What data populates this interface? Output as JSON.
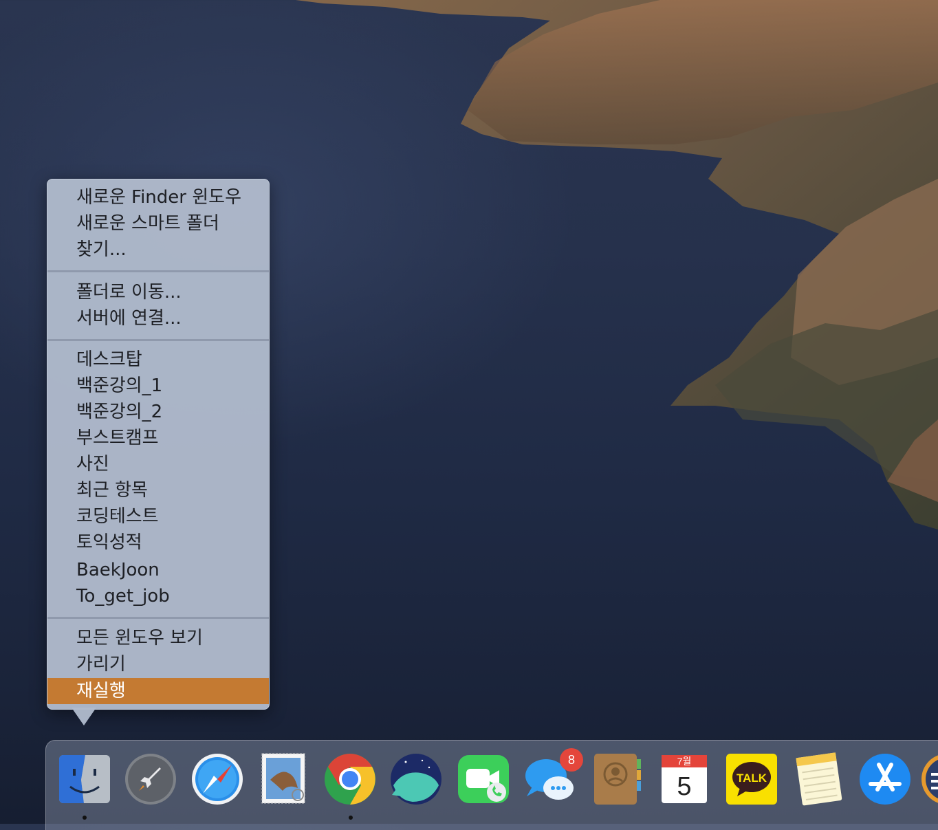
{
  "context_menu": {
    "app": "Finder",
    "groups": [
      [
        "새로운 Finder 윈도우",
        "새로운 스마트 폴더",
        "찾기..."
      ],
      [
        "폴더로 이동...",
        "서버에 연결..."
      ],
      [
        "데스크탑",
        "백준강의_1",
        "백준강의_2",
        "부스트캠프",
        "사진",
        "최근 항목",
        "코딩테스트",
        "토익성적",
        "BaekJoon",
        "To_get_job"
      ],
      [
        "모든 윈도우 보기",
        "가리기",
        "재실행"
      ]
    ],
    "highlighted_item": "재실행",
    "highlight_color": "#c47a32"
  },
  "dock": {
    "apps": [
      {
        "name": "Finder",
        "icon": "finder-icon",
        "running": true
      },
      {
        "name": "Launchpad",
        "icon": "launchpad-icon",
        "running": false
      },
      {
        "name": "Safari",
        "icon": "safari-icon",
        "running": false
      },
      {
        "name": "Mail",
        "icon": "mail-icon",
        "running": false
      },
      {
        "name": "Chrome",
        "icon": "chrome-icon",
        "running": true
      },
      {
        "name": "Whale",
        "icon": "whale-icon",
        "running": false
      },
      {
        "name": "FaceTime",
        "icon": "facetime-icon",
        "running": false
      },
      {
        "name": "Messages",
        "icon": "messages-icon",
        "running": false,
        "badge": "8"
      },
      {
        "name": "Contacts",
        "icon": "contacts-icon",
        "running": false
      },
      {
        "name": "Calendar",
        "icon": "calendar-icon",
        "running": false,
        "month": "7월",
        "day": "5"
      },
      {
        "name": "KakaoTalk",
        "icon": "kakaotalk-icon",
        "running": false,
        "label": "TALK"
      },
      {
        "name": "Notes",
        "icon": "notes-icon",
        "running": false
      },
      {
        "name": "App Store",
        "icon": "app-store-icon",
        "running": false
      },
      {
        "name": "Unknown",
        "icon": "partial-app-icon",
        "running": false
      }
    ]
  }
}
